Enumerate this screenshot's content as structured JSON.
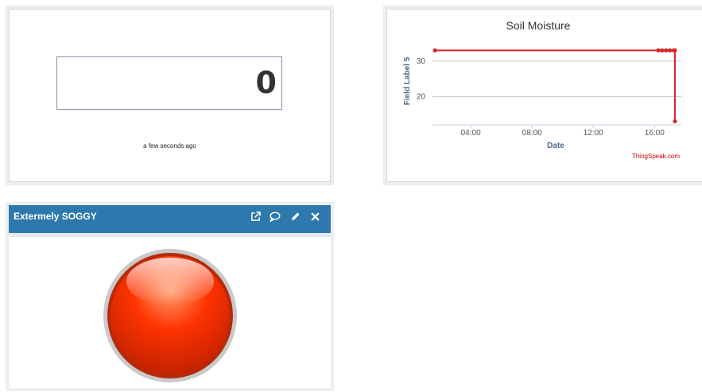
{
  "numeric_widget": {
    "value": "0",
    "timestamp": "a few seconds ago"
  },
  "chart_widget": {
    "credit": "ThingSpeak.com"
  },
  "chart_data": {
    "type": "line",
    "title": "Soil Moisture",
    "xlabel": "Date",
    "ylabel": "Field Label 5",
    "x_ticks": [
      "04:00",
      "08:00",
      "12:00",
      "16:00"
    ],
    "y_ticks": [
      20,
      30
    ],
    "series": [
      {
        "color": "#d62728",
        "x": [
          "01:40",
          "16:15",
          "16:30",
          "16:45",
          "17:00",
          "17:15",
          "17:20",
          "17:20"
        ],
        "y": [
          33,
          33,
          33,
          33,
          33,
          33,
          33,
          13
        ]
      }
    ],
    "ylim": [
      12,
      36
    ],
    "xlim": [
      "01:30",
      "17:45"
    ],
    "grid": true
  },
  "lamp_widget": {
    "title": "Extermely SOGGY",
    "icons": [
      "external-link-icon",
      "comment-icon",
      "pencil-icon",
      "close-icon"
    ],
    "lamp_color": "#ff3300"
  }
}
